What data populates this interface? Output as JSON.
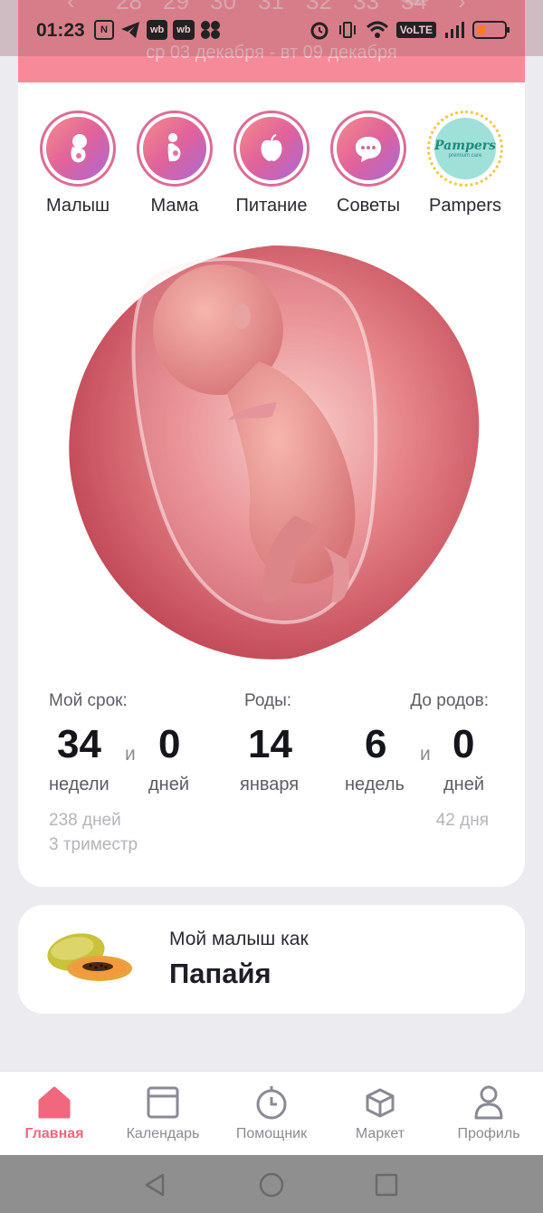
{
  "status_bar": {
    "time": "01:23",
    "left_icons": [
      "N",
      "telegram-icon",
      "wb",
      "wb",
      "apps-icon"
    ],
    "volte": "VoLTE"
  },
  "week_strip": {
    "weeks": [
      "28",
      "29",
      "30",
      "31",
      "32",
      "33",
      "34"
    ],
    "current_week": "34",
    "date_range": "ср 03 декабря - вт 09 декабря"
  },
  "categories": [
    {
      "label": "Малыш",
      "icon": "baby-icon"
    },
    {
      "label": "Мама",
      "icon": "pregnant-mother-icon"
    },
    {
      "label": "Питание",
      "icon": "apple-icon"
    },
    {
      "label": "Советы",
      "icon": "chat-bubble-icon"
    },
    {
      "label": "Pampers",
      "icon": "pampers-logo",
      "logo_text": "Pampers",
      "logo_sub": "premium care"
    }
  ],
  "stats": {
    "term": {
      "caption": "Мой срок:",
      "weeks": "34",
      "and": "и",
      "days": "0",
      "weeks_unit": "недели",
      "days_unit": "дней",
      "total_days": "238 дней",
      "trimester": "3 триместр"
    },
    "birth": {
      "caption": "Роды:",
      "day": "14",
      "month": "января"
    },
    "remaining": {
      "caption": "До родов:",
      "weeks": "6",
      "and": "и",
      "days": "0",
      "weeks_unit": "недель",
      "days_unit": "дней",
      "total_days": "42 дня"
    }
  },
  "fruit": {
    "caption": "Мой малыш как",
    "name": "Папайя"
  },
  "bottom_nav": [
    {
      "label": "Главная",
      "icon": "home-icon",
      "active": true
    },
    {
      "label": "Календарь",
      "icon": "calendar-icon",
      "active": false
    },
    {
      "label": "Помощник",
      "icon": "stopwatch-icon",
      "active": false
    },
    {
      "label": "Маркет",
      "icon": "box-icon",
      "active": false
    },
    {
      "label": "Профиль",
      "icon": "profile-icon",
      "active": false
    }
  ],
  "colors": {
    "accent_pink": "#f78a99",
    "active_nav": "#f0677e",
    "icon_gradient_start": "#f48b8d",
    "icon_gradient_end": "#a96ad6"
  }
}
